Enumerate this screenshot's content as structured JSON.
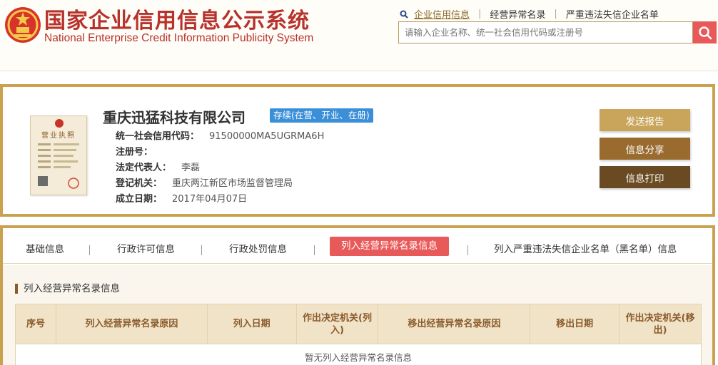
{
  "header": {
    "title_cn": "国家企业信用信息公示系统",
    "title_en": "National Enterprise Credit Information Publicity System",
    "links": [
      "企业信用信息",
      "经营异常名录",
      "严重违法失信企业名单"
    ],
    "search_placeholder": "请输入企业名称、统一社会信用代码或注册号"
  },
  "company": {
    "name": "重庆迅猛科技有限公司",
    "status": "存续(在营、开业、在册)",
    "license_label": "营业执照",
    "fields": [
      {
        "label": "统一社会信用代码：",
        "value": "91500000MA5UGRMA6H"
      },
      {
        "label": "注册号：",
        "value": ""
      },
      {
        "label": "法定代表人：",
        "value": "李磊"
      },
      {
        "label": "登记机关：",
        "value": "重庆两江新区市场监督管理局"
      },
      {
        "label": "成立日期：",
        "value": "2017年04月07日"
      }
    ]
  },
  "actions": {
    "report": "发送报告",
    "share": "信息分享",
    "print": "信息打印"
  },
  "tabs": [
    "基础信息",
    "行政许可信息",
    "行政处罚信息",
    "列入经营异常名录信息",
    "列入严重违法失信企业名单（黑名单）信息"
  ],
  "active_tab": 3,
  "section": {
    "title": "列入经营异常名录信息",
    "columns": [
      "序号",
      "列入经营异常名录原因",
      "列入日期",
      "作出决定机关(列入)",
      "移出经营异常名录原因",
      "移出日期",
      "作出决定机关(移出)"
    ],
    "empty_text": "暂无列入经营异常名录信息"
  },
  "colors": {
    "brand_red": "#b8322c",
    "gold": "#c9a14f",
    "active_tab": "#e85a5a",
    "status_blue": "#3b8fd8"
  }
}
